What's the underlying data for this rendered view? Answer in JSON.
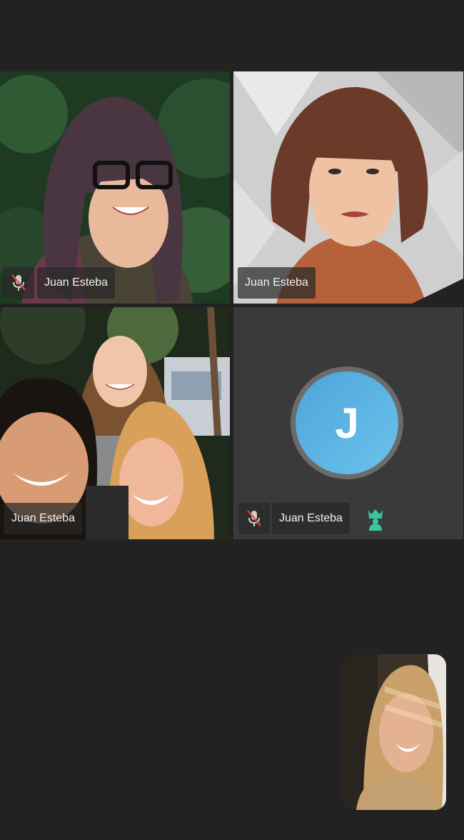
{
  "tiles": [
    {
      "name_label": "Juan Esteba",
      "muted": true,
      "video": "woman-glasses-photo"
    },
    {
      "name_label": "Juan Esteba",
      "muted": false,
      "video": "woman-bangs-photo"
    },
    {
      "name_label": "Juan Esteba",
      "muted": false,
      "video": "group-selfie-photo"
    },
    {
      "name_label": "Juan Esteba",
      "muted": true,
      "avatar_initial": "J",
      "is_host": true,
      "host_icon": "crown-icon"
    }
  ],
  "self_view": {
    "video": "self-video-photo"
  },
  "colors": {
    "background": "#222222",
    "avatar_blue": "#4fa4da",
    "host_icon": "#3cc6a0",
    "muted_slash": "#e0463c"
  }
}
